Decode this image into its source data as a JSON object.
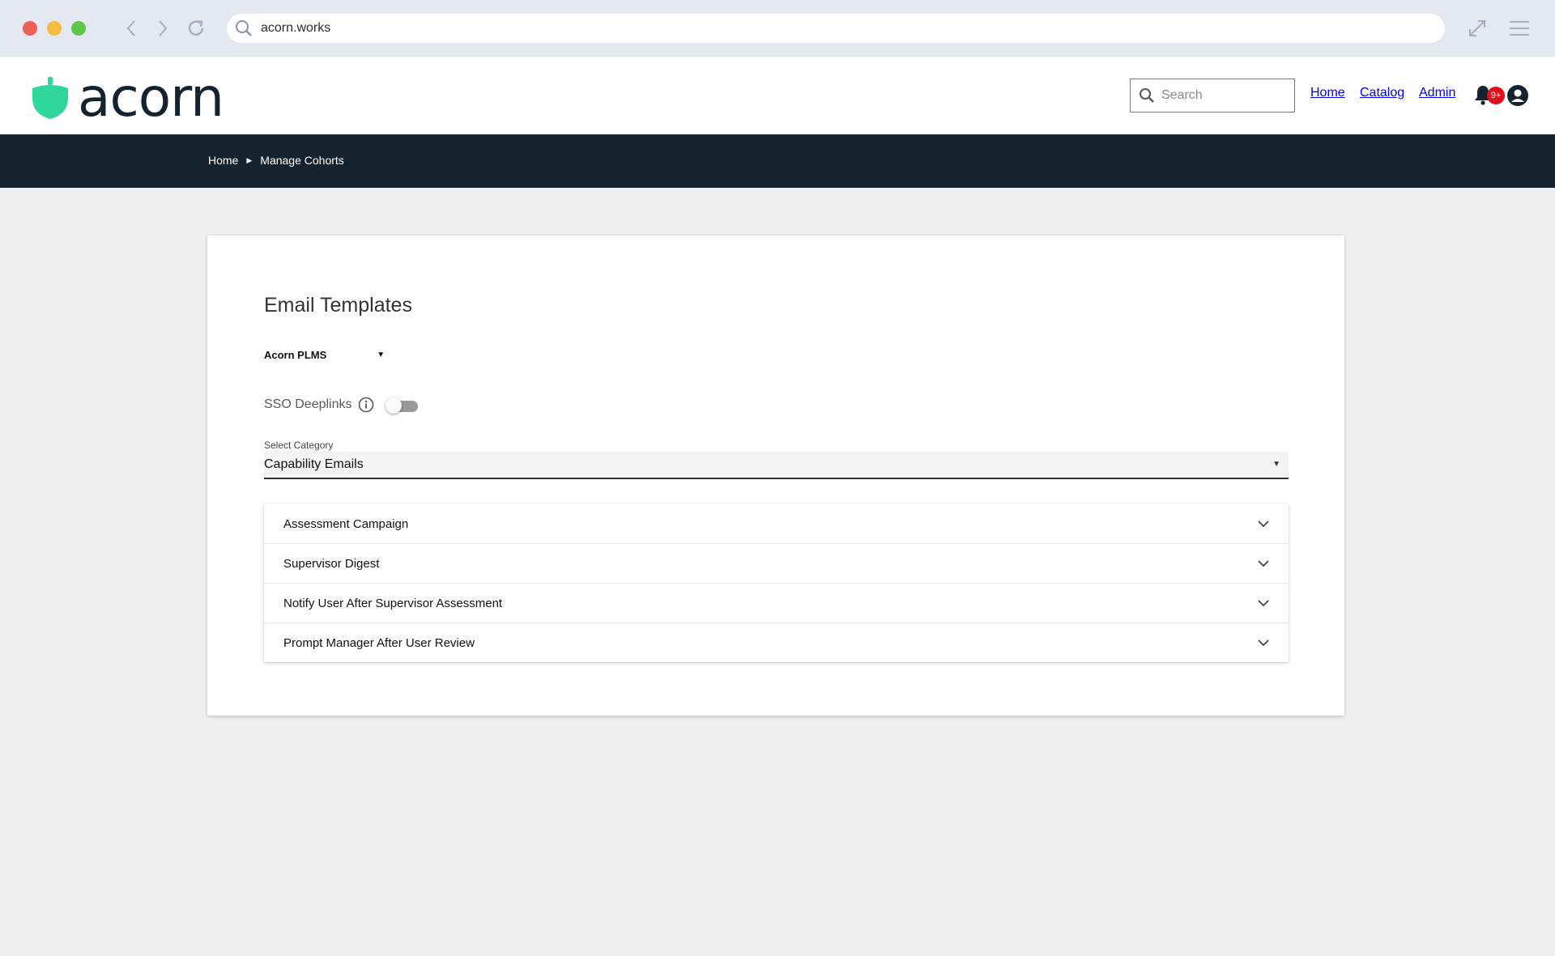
{
  "browser": {
    "url": "acorn.works"
  },
  "header": {
    "logo_text": "acorn",
    "search_placeholder": "Search",
    "nav": [
      "Home",
      "Catalog",
      "Admin"
    ],
    "notification_badge": "9+"
  },
  "breadcrumb": {
    "items": [
      "Home",
      "Manage Cohorts"
    ]
  },
  "page": {
    "title": "Email Templates",
    "org_select_value": "Acorn PLMS",
    "sso_label": "SSO Deeplinks",
    "sso_enabled": false,
    "category_label": "Select Category",
    "category_value": "Capability Emails",
    "templates": [
      "Assessment Campaign",
      "Supervisor Digest",
      "Notify User After Supervisor Assessment",
      "Prompt Manager After User Review"
    ]
  },
  "colors": {
    "brand_green": "#2fd79a",
    "brand_dark": "#15232e",
    "badge_red": "#e0101a"
  }
}
